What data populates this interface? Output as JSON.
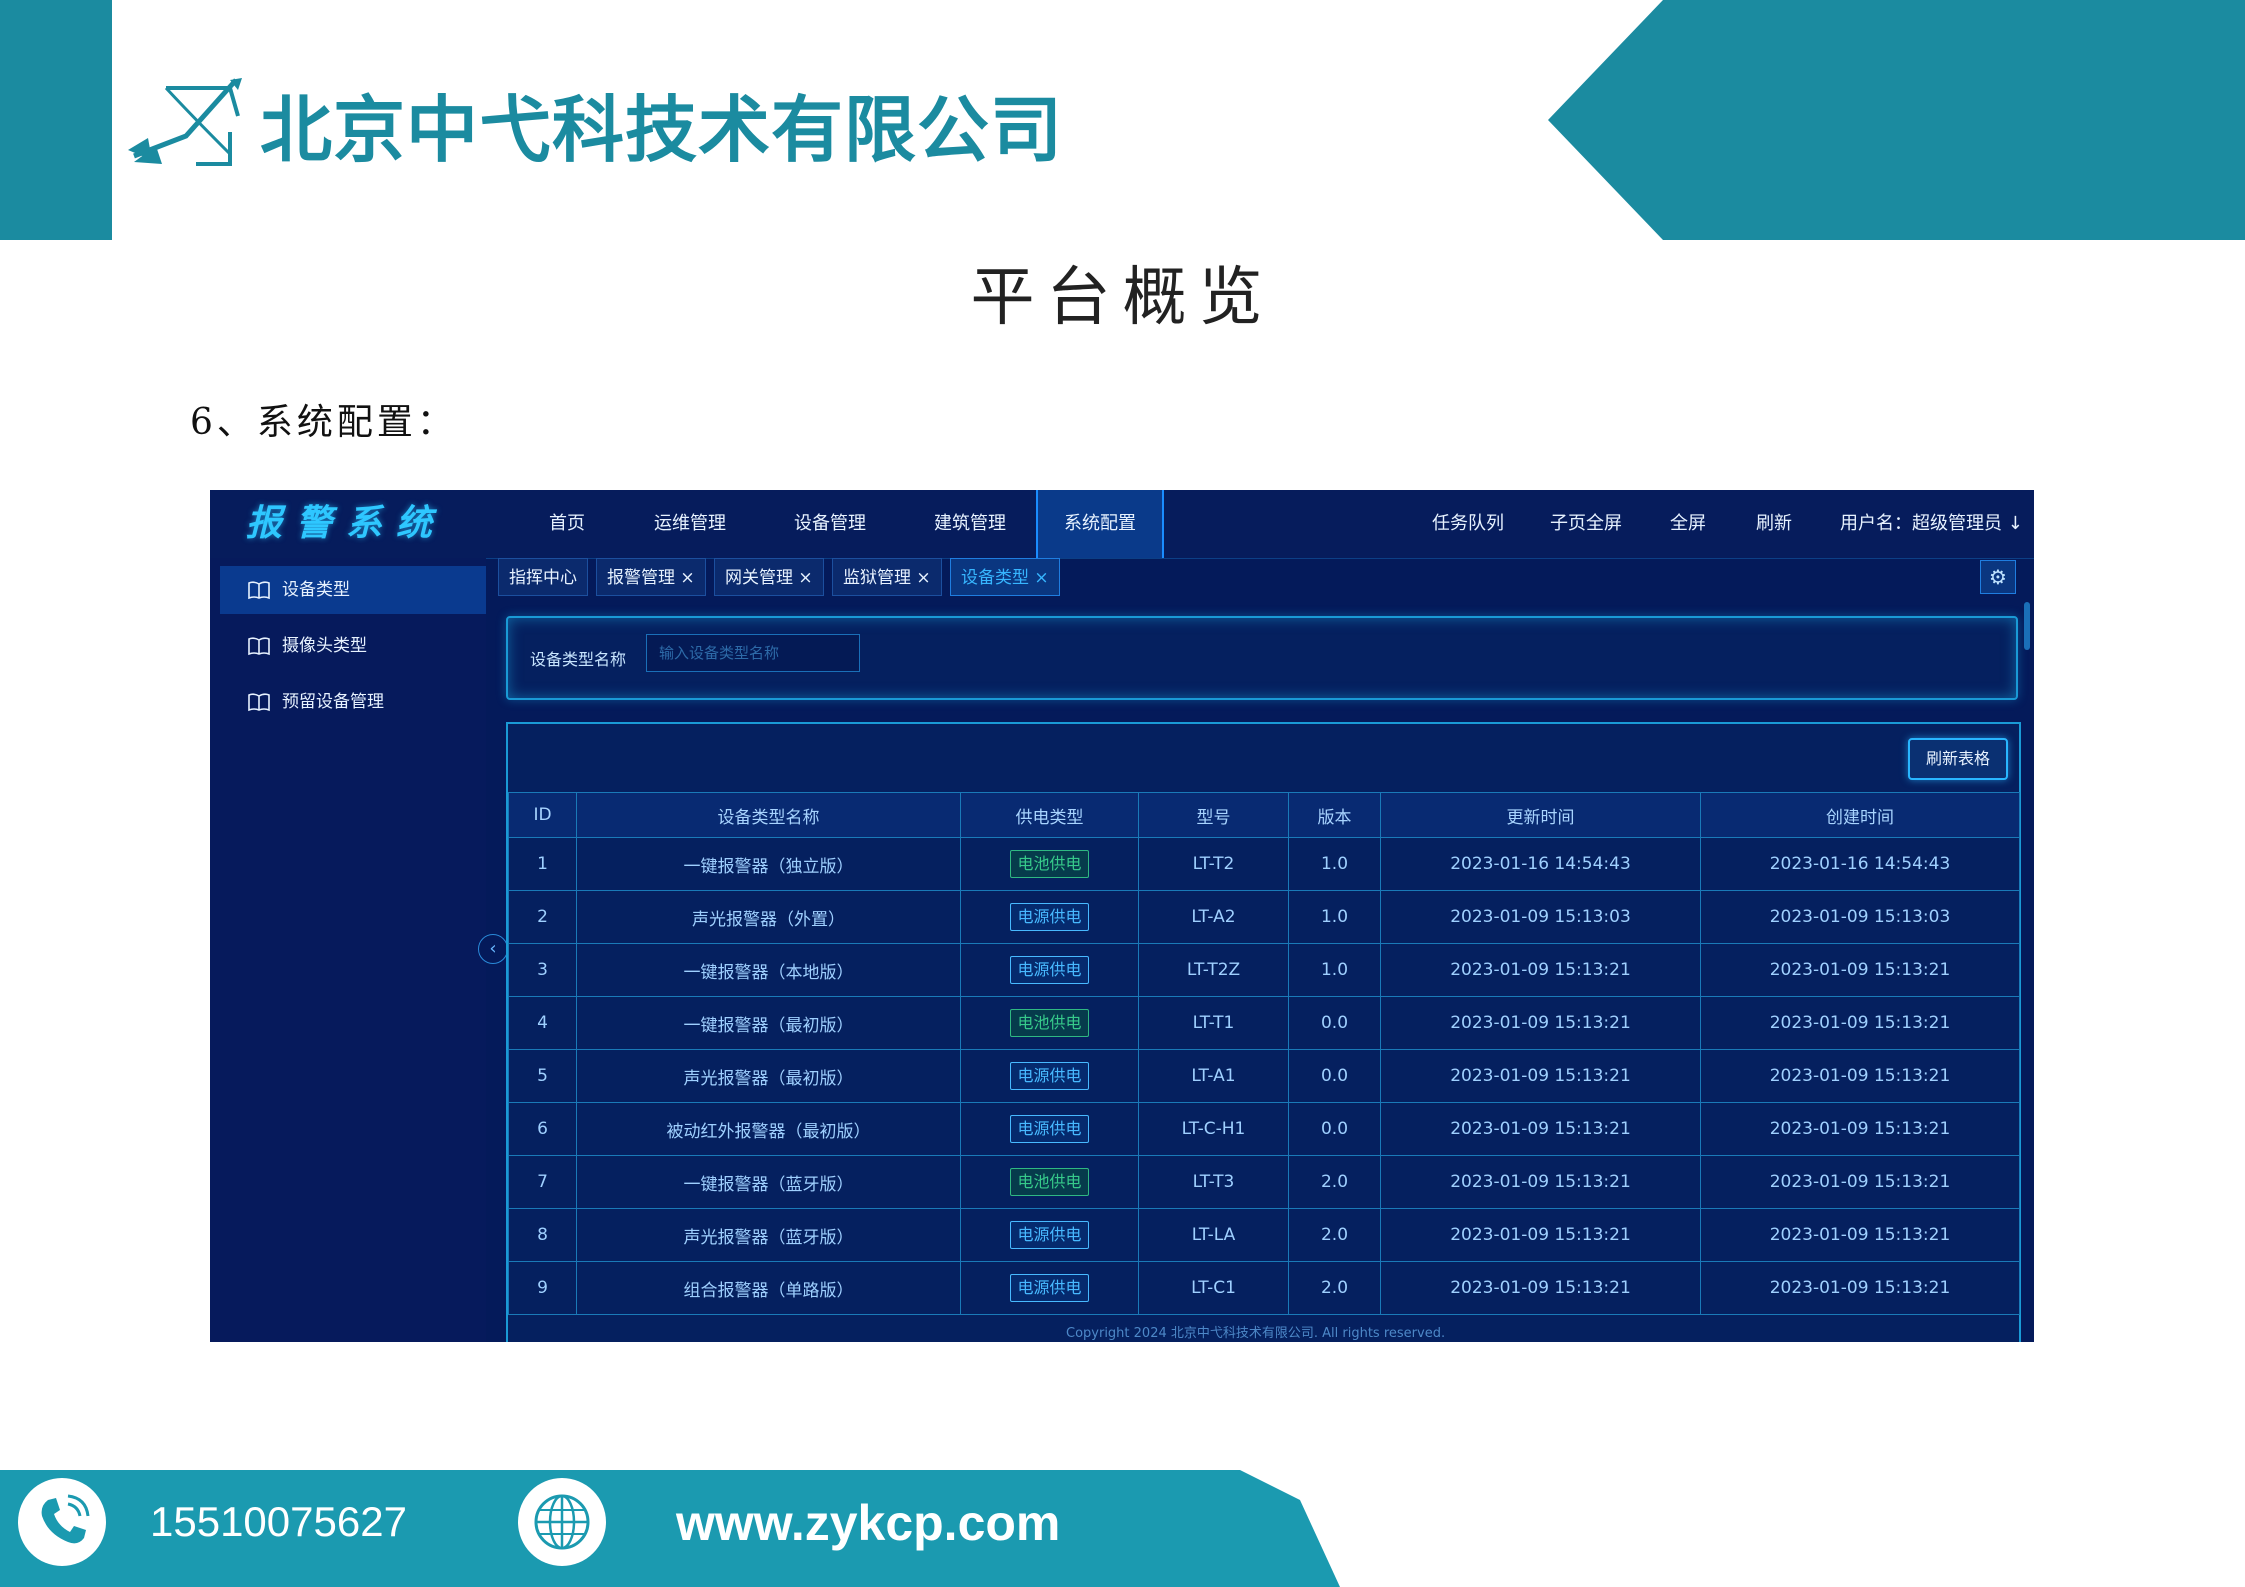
{
  "header": {
    "company_name": "北京中弋科技术有限公司",
    "page_title": "平台概览",
    "section_heading": "6、系统配置：",
    "brand_color": "#1b8ba0"
  },
  "app": {
    "logo_text": "报警系统",
    "nav": [
      {
        "label": "首页"
      },
      {
        "label": "运维管理"
      },
      {
        "label": "设备管理"
      },
      {
        "label": "建筑管理"
      },
      {
        "label": "系统配置"
      }
    ],
    "nav_active": "系统配置",
    "right_menu": {
      "task_queue": "任务队列",
      "sub_fullscreen": "子页全屏",
      "fullscreen": "全屏",
      "refresh": "刷新",
      "user": "用户名：超级管理员 ↓"
    },
    "sidebar": [
      {
        "label": "设备类型",
        "icon": "book-icon"
      },
      {
        "label": "摄像头类型",
        "icon": "book-icon"
      },
      {
        "label": "预留设备管理",
        "icon": "book-icon"
      }
    ],
    "tabs": [
      {
        "label": "指挥中心"
      },
      {
        "label": "报警管理 ×"
      },
      {
        "label": "网关管理 ×"
      },
      {
        "label": "监狱管理 ×"
      },
      {
        "label": "设备类型 ×"
      }
    ],
    "search": {
      "label": "设备类型名称",
      "placeholder": "输入设备类型名称"
    },
    "refresh_table": "刷新表格",
    "table": {
      "columns": [
        "ID",
        "设备类型名称",
        "供电类型",
        "型号",
        "版本",
        "更新时间",
        "创建时间"
      ],
      "rows": [
        {
          "id": "1",
          "name": "一键报警器（独立版）",
          "power": "电池供电",
          "model": "LT-T2",
          "version": "1.0",
          "updated": "2023-01-16 14:54:43",
          "created": "2023-01-16 14:54:43"
        },
        {
          "id": "2",
          "name": "声光报警器（外置）",
          "power": "电源供电",
          "model": "LT-A2",
          "version": "1.0",
          "updated": "2023-01-09 15:13:03",
          "created": "2023-01-09 15:13:03"
        },
        {
          "id": "3",
          "name": "一键报警器（本地版）",
          "power": "电源供电",
          "model": "LT-T2Z",
          "version": "1.0",
          "updated": "2023-01-09 15:13:21",
          "created": "2023-01-09 15:13:21"
        },
        {
          "id": "4",
          "name": "一键报警器（最初版）",
          "power": "电池供电",
          "model": "LT-T1",
          "version": "0.0",
          "updated": "2023-01-09 15:13:21",
          "created": "2023-01-09 15:13:21"
        },
        {
          "id": "5",
          "name": "声光报警器（最初版）",
          "power": "电源供电",
          "model": "LT-A1",
          "version": "0.0",
          "updated": "2023-01-09 15:13:21",
          "created": "2023-01-09 15:13:21"
        },
        {
          "id": "6",
          "name": "被动红外报警器（最初版）",
          "power": "电源供电",
          "model": "LT-C-H1",
          "version": "0.0",
          "updated": "2023-01-09 15:13:21",
          "created": "2023-01-09 15:13:21"
        },
        {
          "id": "7",
          "name": "一键报警器（蓝牙版）",
          "power": "电池供电",
          "model": "LT-T3",
          "version": "2.0",
          "updated": "2023-01-09 15:13:21",
          "created": "2023-01-09 15:13:21"
        },
        {
          "id": "8",
          "name": "声光报警器（蓝牙版）",
          "power": "电源供电",
          "model": "LT-LA",
          "version": "2.0",
          "updated": "2023-01-09 15:13:21",
          "created": "2023-01-09 15:13:21"
        },
        {
          "id": "9",
          "name": "组合报警器（单路版）",
          "power": "电源供电",
          "model": "LT-C1",
          "version": "2.0",
          "updated": "2023-01-09 15:13:21",
          "created": "2023-01-09 15:13:21"
        }
      ]
    },
    "copyright": "Copyright 2024 北京中弋科技术有限公司. All rights reserved.",
    "colors": {
      "background": "#041a5a",
      "accent": "#1a9ad6",
      "battery": "#36c98a",
      "power": "#48b9ff"
    }
  },
  "footer": {
    "phone": "15510075627",
    "website": "www.zykcp.com",
    "phone_icon": "phone-icon",
    "globe_icon": "globe-icon"
  }
}
